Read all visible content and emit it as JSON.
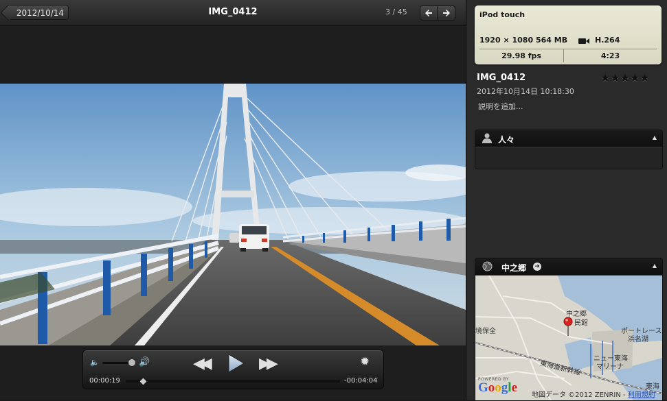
{
  "viewer": {
    "back_label": "2012/10/14",
    "title": "IMG_0412",
    "counter": "3 / 45",
    "prev_arrow": "🡐",
    "next_arrow": "🡒"
  },
  "player": {
    "elapsed": "00:00:19",
    "remaining": "-00:04:04",
    "volume_fraction": 0.8,
    "progress_fraction": 0.07,
    "icons": [
      "speaker-low-icon",
      "speaker-high-icon",
      "rewind-icon",
      "play-icon",
      "fast-forward-icon",
      "gear-icon"
    ]
  },
  "info": {
    "camera": {
      "name": "iPod touch",
      "resolution": "1920 × 1080",
      "file_size": "564 MB",
      "codec": "H.264",
      "fps": "29.98 fps",
      "duration": "4:23"
    },
    "filename": "IMG_0412",
    "datetime": "2012年10月14日 10:18:30",
    "description_placeholder": "説明を追加...",
    "rating": 0,
    "stars": "★★★★★",
    "people_title": "人々",
    "location_title": "中之郷"
  },
  "map": {
    "labels": {
      "place": "中之郷",
      "place2": "民館",
      "harbor": "境保全",
      "port": "ポートレース",
      "port2": "浜名湖",
      "marina": "ニュー東海",
      "marina2": "マリーナ",
      "rail": "東海道新幹線",
      "east": "東海"
    },
    "powered_by": "POWERED BY",
    "google": "Google",
    "copyright": "地図データ ©2012 ZENRIN -",
    "terms": "利用規約"
  },
  "colors": {
    "card_bg": "#e9e9d6",
    "panel_bg": "#242424",
    "accent_pin": "#d6231f"
  }
}
